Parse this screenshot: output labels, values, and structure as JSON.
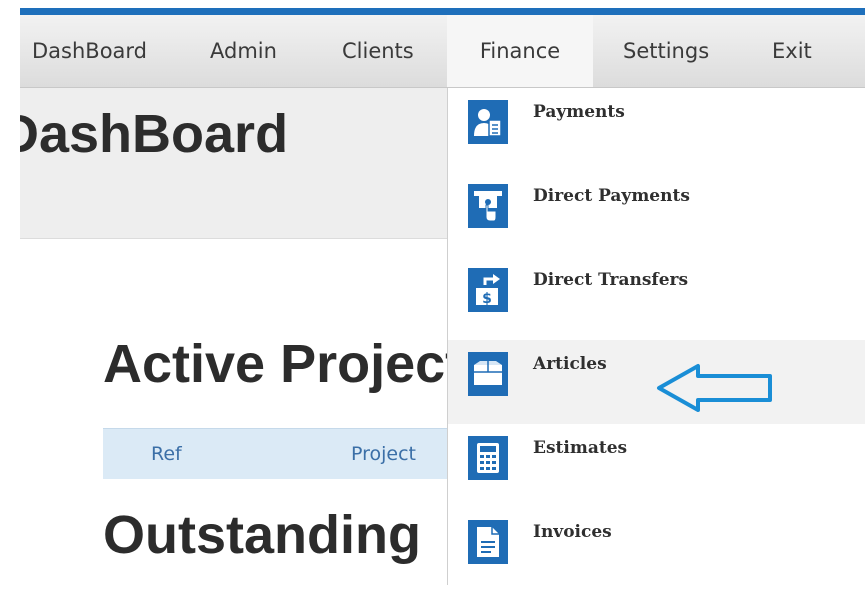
{
  "nav": {
    "items": [
      {
        "label": "DashBoard"
      },
      {
        "label": "Admin"
      },
      {
        "label": "Clients"
      },
      {
        "label": "Finance"
      },
      {
        "label": "Settings"
      },
      {
        "label": "Exit"
      }
    ],
    "active": "Finance"
  },
  "page": {
    "title": "DashBoard",
    "sections": {
      "active_projects": "Active Projects",
      "outstanding": "Outstanding"
    },
    "table_headers": [
      "Ref",
      "Project"
    ]
  },
  "finance_menu": {
    "items": [
      {
        "label": "Payments",
        "icon": "payments-icon"
      },
      {
        "label": "Direct Payments",
        "icon": "direct-payments-icon"
      },
      {
        "label": "Direct Transfers",
        "icon": "direct-transfers-icon"
      },
      {
        "label": "Articles",
        "icon": "articles-icon"
      },
      {
        "label": "Estimates",
        "icon": "calculator-icon"
      },
      {
        "label": "Invoices",
        "icon": "invoice-icon"
      }
    ],
    "highlighted": "Articles"
  },
  "colors": {
    "accent": "#1e6fbb",
    "icon_bg": "#1f6cb5",
    "pointer_arrow": "#1a8ed6"
  }
}
